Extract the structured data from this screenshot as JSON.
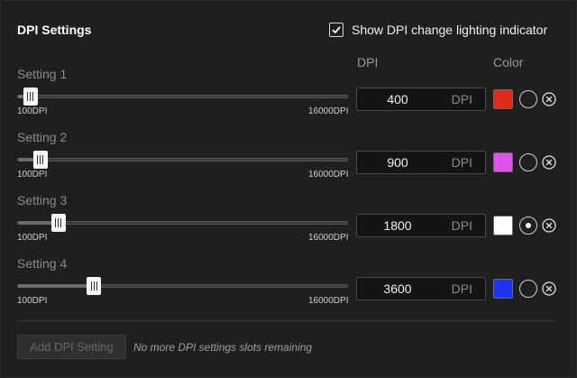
{
  "panel": {
    "title": "DPI Settings",
    "show_indicator": {
      "label": "Show DPI change lighting indicator",
      "checked": true
    }
  },
  "columns": {
    "dpi": "DPI",
    "color": "Color"
  },
  "slider": {
    "min_label": "100DPI",
    "max_label": "16000DPI",
    "min": 100,
    "max": 16000
  },
  "settings": [
    {
      "label": "Setting 1",
      "dpi": "400",
      "unit": "DPI",
      "color": "#e22a1a",
      "selected": false
    },
    {
      "label": "Setting 2",
      "dpi": "900",
      "unit": "DPI",
      "color": "#e052ec",
      "selected": false
    },
    {
      "label": "Setting 3",
      "dpi": "1800",
      "unit": "DPI",
      "color": "#ffffff",
      "selected": true
    },
    {
      "label": "Setting 4",
      "dpi": "3600",
      "unit": "DPI",
      "color": "#1f33f3",
      "selected": false
    }
  ],
  "footer": {
    "add_label": "Add DPI Setting",
    "add_enabled": false,
    "message": "No more DPI settings slots remaining"
  }
}
